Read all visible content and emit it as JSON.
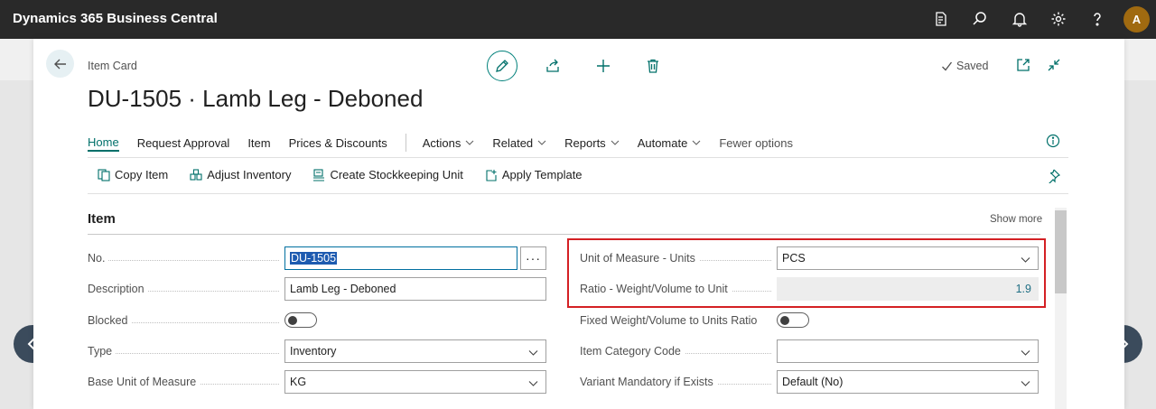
{
  "app": {
    "title": "Dynamics 365 Business Central",
    "avatar_initial": "A",
    "icons": [
      "document-search-icon",
      "search-icon",
      "bell-icon",
      "gear-icon",
      "help-icon"
    ]
  },
  "page": {
    "caption": "Item Card",
    "title": "DU-1505 · Lamb Leg - Deboned",
    "saved_label": "Saved"
  },
  "menu": {
    "items": [
      {
        "label": "Home",
        "active": true
      },
      {
        "label": "Request Approval"
      },
      {
        "label": "Item"
      },
      {
        "label": "Prices & Discounts"
      },
      {
        "label": "Actions",
        "dropdown": true
      },
      {
        "label": "Related",
        "dropdown": true
      },
      {
        "label": "Reports",
        "dropdown": true
      },
      {
        "label": "Automate",
        "dropdown": true
      },
      {
        "label": "Fewer options"
      }
    ]
  },
  "subactions": [
    {
      "label": "Copy Item",
      "icon": "copy-icon"
    },
    {
      "label": "Adjust Inventory",
      "icon": "inventory-icon"
    },
    {
      "label": "Create Stockkeeping Unit",
      "icon": "stockkeeping-icon"
    },
    {
      "label": "Apply Template",
      "icon": "template-icon"
    }
  ],
  "section": {
    "title": "Item",
    "show_more": "Show more"
  },
  "fields": {
    "no": {
      "label": "No.",
      "value": "DU-1505"
    },
    "description": {
      "label": "Description",
      "value": "Lamb Leg - Deboned"
    },
    "blocked": {
      "label": "Blocked",
      "on": false
    },
    "type": {
      "label": "Type",
      "value": "Inventory"
    },
    "base_uom": {
      "label": "Base Unit of Measure",
      "value": "KG"
    },
    "uom_units": {
      "label": "Unit of Measure - Units",
      "value": "PCS"
    },
    "ratio": {
      "label": "Ratio - Weight/Volume to Unit",
      "value": "1.9"
    },
    "fixed_weight": {
      "label": "Fixed Weight/Volume to Units Ratio",
      "on": false
    },
    "item_category": {
      "label": "Item Category Code",
      "value": ""
    },
    "variant_mandatory": {
      "label": "Variant Mandatory if Exists",
      "value": "Default (No)"
    }
  },
  "colors": {
    "accent": "#00706a",
    "appbar": "#292929",
    "highlight": "#d42024"
  }
}
